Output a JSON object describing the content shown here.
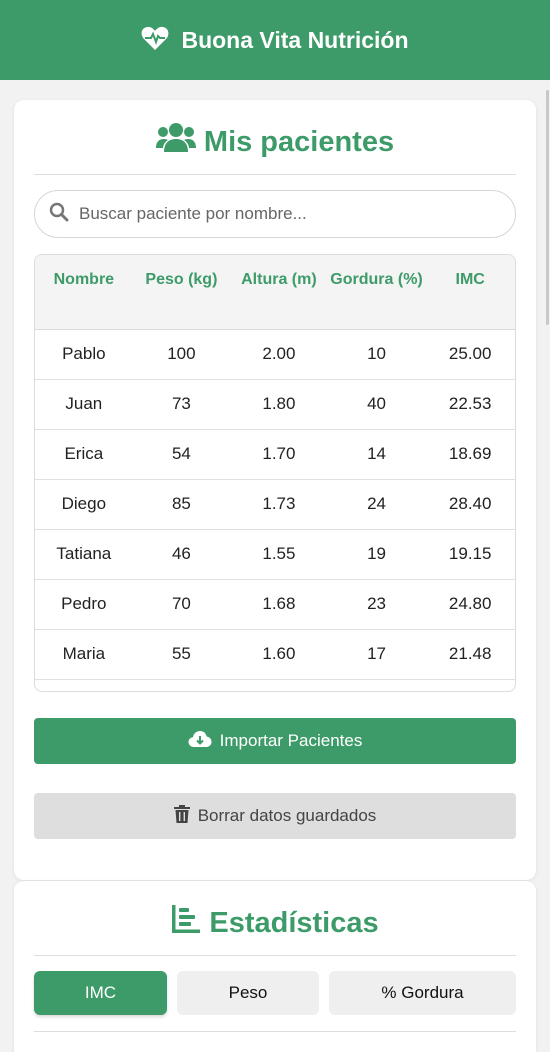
{
  "header": {
    "title": "Buona Vita Nutrición",
    "icon": "heart-pulse-icon"
  },
  "patients_card": {
    "title": "Mis pacientes",
    "icon": "users-icon",
    "search": {
      "placeholder": "Buscar paciente por nombre...",
      "value": ""
    },
    "table": {
      "headers": {
        "nombre": "Nombre",
        "peso": "Peso (kg)",
        "altura": "Altura (m)",
        "gordura": "Gordura (%)",
        "imc": "IMC"
      },
      "rows": [
        {
          "nombre": "Pablo",
          "peso": "100",
          "altura": "2.00",
          "gordura": "10",
          "imc": "25.00"
        },
        {
          "nombre": "Juan",
          "peso": "73",
          "altura": "1.80",
          "gordura": "40",
          "imc": "22.53"
        },
        {
          "nombre": "Erica",
          "peso": "54",
          "altura": "1.70",
          "gordura": "14",
          "imc": "18.69"
        },
        {
          "nombre": "Diego",
          "peso": "85",
          "altura": "1.73",
          "gordura": "24",
          "imc": "28.40"
        },
        {
          "nombre": "Tatiana",
          "peso": "46",
          "altura": "1.55",
          "gordura": "19",
          "imc": "19.15"
        },
        {
          "nombre": "Pedro",
          "peso": "70",
          "altura": "1.68",
          "gordura": "23",
          "imc": "24.80"
        },
        {
          "nombre": "Maria",
          "peso": "55",
          "altura": "1.60",
          "gordura": "17",
          "imc": "21.48"
        }
      ]
    },
    "import_button": "Importar Pacientes",
    "delete_button": "Borrar datos guardados"
  },
  "stats_card": {
    "title": "Estadísticas",
    "icon": "chart-bar-icon",
    "tabs": [
      {
        "label": "IMC",
        "active": true
      },
      {
        "label": "Peso",
        "active": false
      },
      {
        "label": "% Gordura",
        "active": false
      }
    ]
  },
  "colors": {
    "brand": "#3d9b69",
    "muted_button": "#dedede",
    "tab_inactive": "#efefef"
  }
}
